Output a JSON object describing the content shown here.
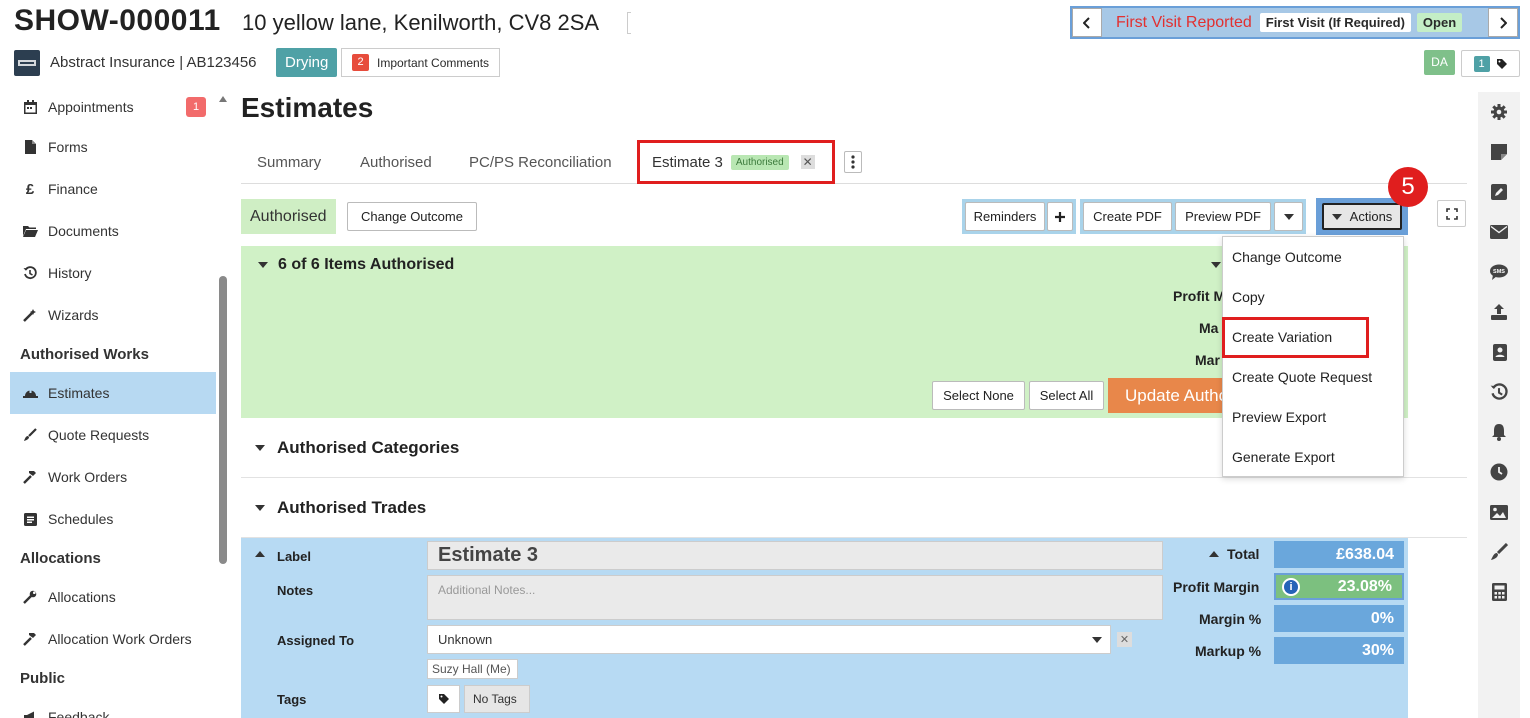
{
  "header": {
    "job_id": "SHOW-000011",
    "address": "10 yellow lane, Kenilworth, CV8 2SA",
    "insurer": "Abstract Insurance | AB123456",
    "status_badge": "Drying",
    "comments": {
      "count": "2",
      "label": "Important Comments"
    },
    "workflow": {
      "current": "First Visit Reported",
      "next": "First Visit (If Required)",
      "state": "Open"
    },
    "user_initials": "DA",
    "tag_count": "1"
  },
  "sidebar": {
    "items_top": [
      {
        "label": "Appointments",
        "icon": "calendar-icon",
        "badge": "1"
      },
      {
        "label": "Forms",
        "icon": "file-icon"
      },
      {
        "label": "Finance",
        "icon": "pound-icon"
      },
      {
        "label": "Documents",
        "icon": "folder-icon"
      },
      {
        "label": "History",
        "icon": "history-icon"
      },
      {
        "label": "Wizards",
        "icon": "magic-wand-icon"
      }
    ],
    "section_authorised": "Authorised Works",
    "items_authorised": [
      {
        "label": "Estimates",
        "icon": "hard-hat-icon",
        "active": true
      },
      {
        "label": "Quote Requests",
        "icon": "brush-icon"
      },
      {
        "label": "Work Orders",
        "icon": "hammer-icon"
      },
      {
        "label": "Schedules",
        "icon": "schedule-icon"
      }
    ],
    "section_allocations": "Allocations",
    "items_allocations": [
      {
        "label": "Allocations",
        "icon": "wrench-icon"
      },
      {
        "label": "Allocation Work Orders",
        "icon": "hammer-icon"
      }
    ],
    "section_public": "Public",
    "items_public": [
      {
        "label": "Feedback",
        "icon": "megaphone-icon"
      }
    ]
  },
  "main": {
    "title": "Estimates",
    "tabs": [
      "Summary",
      "Authorised",
      "PC/PS Reconciliation"
    ],
    "active_tab": {
      "label": "Estimate 3",
      "badge": "Authorised"
    },
    "outcome": "Authorised",
    "change_outcome": "Change Outcome",
    "reminders": "Reminders",
    "create_pdf": "Create PDF",
    "preview_pdf": "Preview PDF",
    "actions": "Actions",
    "green_panel": {
      "title": "6 of 6 Items Authorised",
      "row1": "Profit M",
      "row2": "Ma",
      "row3": "Mar",
      "select_none": "Select None",
      "select_all": "Select All",
      "update": "Update Authorised"
    },
    "authorised_categories": "Authorised Categories",
    "authorised_trades": "Authorised Trades",
    "estimate": {
      "label_label": "Label",
      "label_value": "Estimate 3",
      "notes_label": "Notes",
      "notes_placeholder": "Additional Notes...",
      "assigned_label": "Assigned To",
      "assigned_value": "Unknown",
      "suggestion": "Suzy Hall (Me)",
      "tags_label": "Tags",
      "no_tags": "No Tags",
      "total_label": "Total",
      "total_value": "£638.04",
      "profit_label": "Profit Margin",
      "profit_value": "23.08%",
      "margin_label": "Margin %",
      "margin_value": "0%",
      "markup_label": "Markup %",
      "markup_value": "30%"
    }
  },
  "actions_menu": [
    "Change Outcome",
    "Copy",
    "Create Variation",
    "Create Quote Request",
    "Preview Export",
    "Generate Export"
  ],
  "step_number": "5",
  "colors": {
    "accent_red": "#e01e1e",
    "green_panel": "#d0f1c6",
    "blue_panel": "#b7daf3",
    "active_nav": "#b7d9f2"
  }
}
